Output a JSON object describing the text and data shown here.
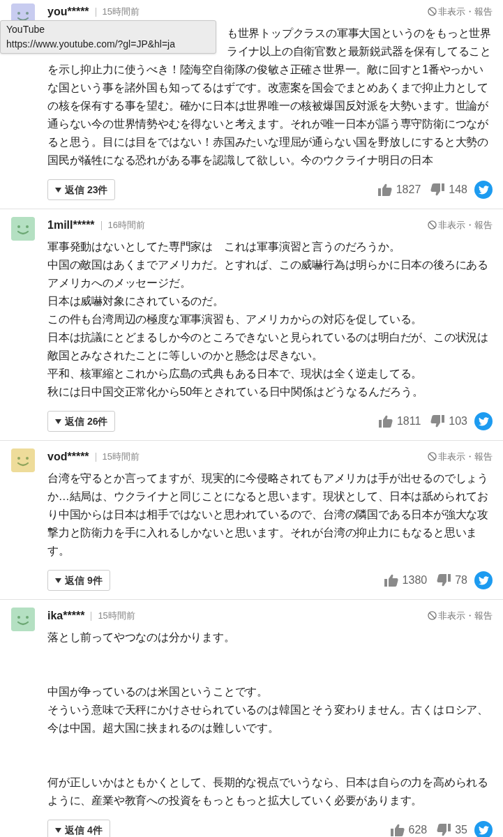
{
  "tooltip": {
    "title": "YouTube",
    "url": "https://www.youtube.com/?gl=JP&hl=ja"
  },
  "comments": [
    {
      "user": "you*****",
      "time": "15時間前",
      "avatar": {
        "color": "#c8ccf0"
      },
      "report": "非表示・報告",
      "covered_lines": [
        "も世界トップクラスの軍事大国というのをもっと世界",
        "ライナ以上の自衛官数と最新鋭武器を保有してること"
      ],
      "blocks": [
        [
          "を示し抑止力に使うべき！陸海空自衛隊の俊敏さ正確さ世界一。敵に回すと1番やっかいな国という事を諸外国も知ってるはずです。改憲案を国会でまとめあくまで抑止力としての核を保有する事を望む。確かに日本は世界唯一の核被爆国反対派を大勢います。世論が通らない今の世界情勢やむを得ないと考えます。それが唯一日本が謳う専守防衛につながると思う。目には目をではない！赤国みたいな理屈が通らない国を野放しにすると大勢の国民が犠牲になる恐れがある事を認識して欲しい。今のウクライナ明日の日本"
        ]
      ],
      "replies": "返信 23件",
      "likes": "1827",
      "dislikes": "148"
    },
    {
      "user": "1mill*****",
      "time": "16時間前",
      "avatar": {
        "color": "#b4e0c2"
      },
      "report": "非表示・報告",
      "blocks": [
        [
          "軍事発動はないとしてた専門家は　これは軍事演習と言うのだろうか。",
          "中国の敵国はあくまでアメリカだ。とすれば、この威嚇行為は明らかに日本の後ろにあるアメリカへのメッセージだ。",
          "日本は威嚇対象にされているのだ。",
          "この件も台湾周辺の極度な軍事演習も、アメリカからの対応を促している。",
          "日本は抗議にとどまるしか今のところできないと見られているのは明白だが、この状況は敵国とみなされたことに等しいのかと懸念は尽きない。",
          "平和、核軍縮とこれから広島の式典もある日本で、現状は全く逆走してる。",
          "秋には日中国交正常化から50年とされている日中関係はどうなるんだろう。"
        ]
      ],
      "replies": "返信 26件",
      "likes": "1811",
      "dislikes": "103"
    },
    {
      "user": "vod*****",
      "time": "15時間前",
      "avatar": {
        "color": "#eedc9a"
      },
      "report": "非表示・報告",
      "blocks": [
        [
          "台湾を守るとか言ってますが、現実的に今侵略されてもアメリカは手が出せるのでしょうか…結局は、ウクライナと同じことになると思います。現状として、日本は舐められており中国からは日本は相手ではないと思われているので、台湾の隣国である日本が強大な攻撃力と防衛力を手に入れるしかないと思います。それが台湾の抑止力にもなると思います。"
        ]
      ],
      "replies": "返信 9件",
      "likes": "1380",
      "dislikes": "78"
    },
    {
      "user": "ika*****",
      "time": "15時間前",
      "avatar": {
        "color": "#b4e0c2"
      },
      "report": "非表示・報告",
      "blocks": [
        [
          "落とし前ってやつなのは分かります。"
        ],
        [
          "中国が争っているのは米国ということです。",
          "そういう意味で天秤にかけさせられているのは韓国とそう変わりません。古くはロシア、今は中国。超大国に挟まれるのは難しいです。"
        ],
        [
          "何が正しいかはともかくとして、長期的な視点でいうなら、日本は自らの力を高められるように、産業や教育への投資をもっともっと拡大していく必要があります。"
        ]
      ],
      "replies": "返信 4件",
      "likes": "628",
      "dislikes": "35"
    }
  ]
}
